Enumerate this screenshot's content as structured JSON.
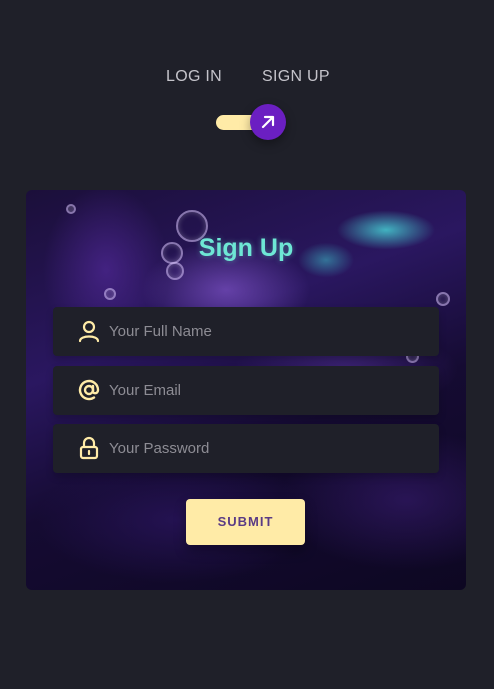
{
  "switcher": {
    "login_label": "LOG IN",
    "signup_label": "SIGN UP",
    "toggle_state": "signup",
    "toggle_icon": "arrow-up-right-icon"
  },
  "form": {
    "title": "Sign Up",
    "fields": [
      {
        "icon": "user-icon",
        "placeholder": "Your Full Name",
        "value": ""
      },
      {
        "icon": "at-icon",
        "placeholder": "Your Email",
        "value": ""
      },
      {
        "icon": "lock-icon",
        "placeholder": "Your Password",
        "value": ""
      }
    ],
    "submit_label": "SUBMIT"
  },
  "colors": {
    "background": "#1f2029",
    "accent": "#ffeba7",
    "knob": "#6b1fc2",
    "title": "#6ee7d5",
    "field_bg": "#1f2029"
  }
}
